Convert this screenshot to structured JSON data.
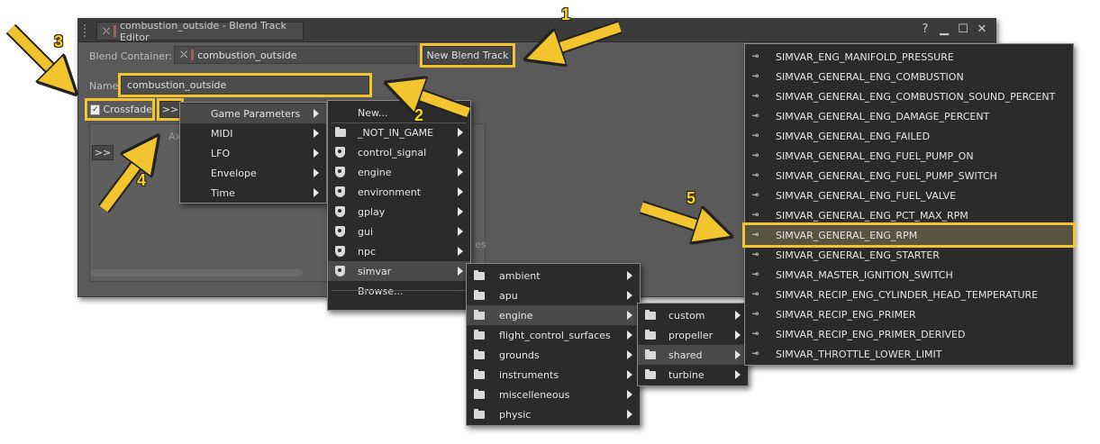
{
  "window": {
    "title": "combustion_outside - Blend Track Editor",
    "controls": {
      "help": "?",
      "minimize": "▁",
      "maximize": "☐",
      "close": "✕"
    }
  },
  "blend_container": {
    "label": "Blend Container:",
    "value": "combustion_outside"
  },
  "new_blend_track_label": "New Blend Track",
  "name": {
    "label": "Name:",
    "value": "combustion_outside"
  },
  "crossfade": {
    "label": "Crossfade",
    "checked": true
  },
  "expand_button": ">>",
  "side_button": ">>",
  "axis_tab_fragment": "Ax",
  "bg_fragment": "es",
  "menu1": [
    "Game Parameters",
    "MIDI",
    "LFO",
    "Envelope",
    "Time"
  ],
  "menu2": [
    "New...",
    "_NOT_IN_GAME",
    "control_signal",
    "engine",
    "environment",
    "gplay",
    "gui",
    "npc",
    "simvar",
    "Browse..."
  ],
  "menu3": [
    "ambient",
    "apu",
    "engine",
    "flight_control_surfaces",
    "grounds",
    "instruments",
    "miscelleneous",
    "physic"
  ],
  "menu4": [
    "custom",
    "propeller",
    "shared",
    "turbine"
  ],
  "menu5": [
    "SIMVAR_ENG_MANIFOLD_PRESSURE",
    "SIMVAR_GENERAL_ENG_COMBUSTION",
    "SIMVAR_GENERAL_ENG_COMBUSTION_SOUND_PERCENT",
    "SIMVAR_GENERAL_ENG_DAMAGE_PERCENT",
    "SIMVAR_GENERAL_ENG_FAILED",
    "SIMVAR_GENERAL_ENG_FUEL_PUMP_ON",
    "SIMVAR_GENERAL_ENG_FUEL_PUMP_SWITCH",
    "SIMVAR_GENERAL_ENG_FUEL_VALVE",
    "SIMVAR_GENERAL_ENG_PCT_MAX_RPM",
    "SIMVAR_GENERAL_ENG_RPM",
    "SIMVAR_GENERAL_ENG_STARTER",
    "SIMVAR_MASTER_IGNITION_SWITCH",
    "SIMVAR_RECIP_ENG_CYLINDER_HEAD_TEMPERATURE",
    "SIMVAR_RECIP_ENG_PRIMER",
    "SIMVAR_RECIP_ENG_PRIMER_DERIVED",
    "SIMVAR_THROTTLE_LOWER_LIMIT"
  ],
  "callouts": [
    "1",
    "2",
    "3",
    "4",
    "5"
  ],
  "colors": {
    "accent": "#f2c42d",
    "menu_bg": "#2b2b2b",
    "window_bg": "#5a5a5a"
  }
}
